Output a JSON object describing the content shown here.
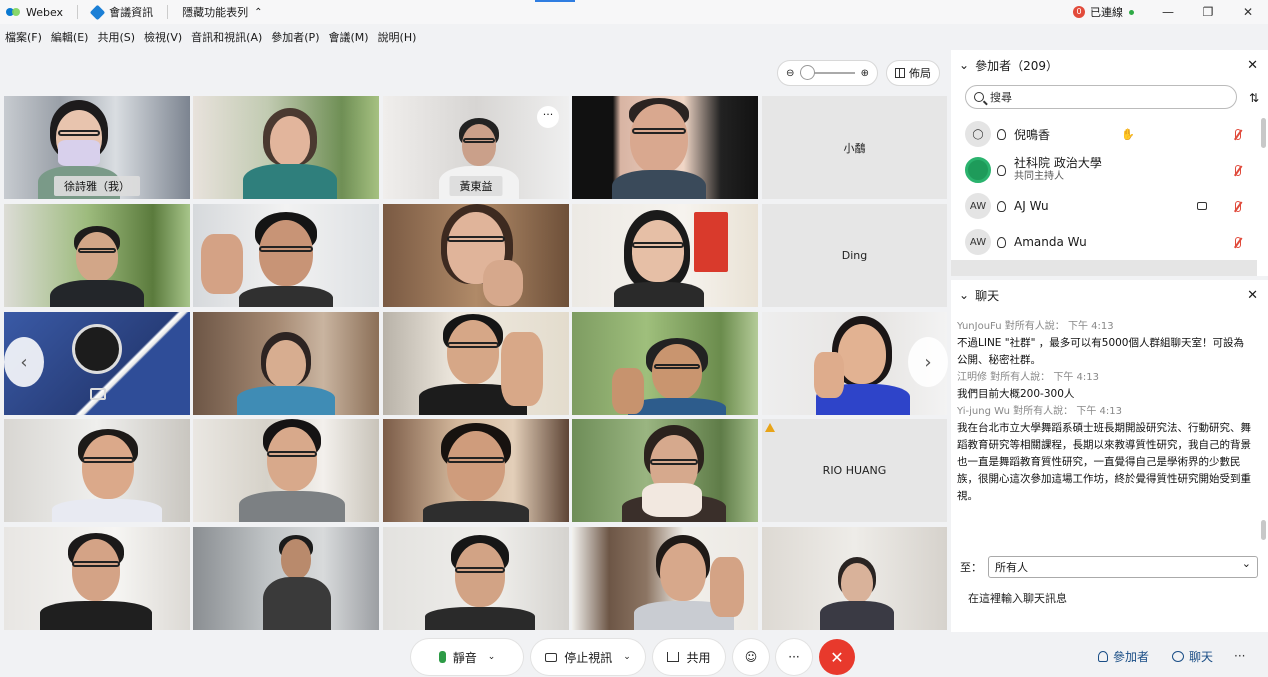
{
  "titlebar": {
    "app_name": "Webex",
    "meeting_info": "會議資訊",
    "hide_menu": "隱藏功能表列",
    "connection_count": "0",
    "connection_status": "已連線",
    "win_min": "—",
    "win_restore": "❐",
    "win_close": "✕"
  },
  "menu": [
    "檔案(F)",
    "編輯(E)",
    "共用(S)",
    "檢視(V)",
    "音訊和視訊(A)",
    "參加者(P)",
    "會議(M)",
    "說明(H)"
  ],
  "view": {
    "layout_label": "佈局",
    "zoom_level": 0.0
  },
  "tiles": {
    "self_name": "徐詩雅（我）",
    "t3_name": "黃東益",
    "t5_name": "小鷸",
    "t10_name": "Ding",
    "t20_name": "RIO HUANG",
    "more": "···"
  },
  "participants": {
    "title": "參加者（209）",
    "search_placeholder": "搜尋",
    "rows": [
      {
        "name": "倪鳴香",
        "avatar": "",
        "raised_hand": true,
        "muted": true
      },
      {
        "name": "社科院 政治大學",
        "sub": "共同主持人",
        "avatar": "",
        "muted": true
      },
      {
        "name": "AJ Wu",
        "avatar": "AW",
        "camera": true,
        "muted": true
      },
      {
        "name": "Amanda Wu",
        "avatar": "AW",
        "muted": true
      }
    ]
  },
  "chat": {
    "title": "聊天",
    "messages": [
      {
        "meta": "YunJouFu 對所有人說：    下午 4:13",
        "text": "不過LINE \"社群\" ，最多可以有5000個人群組聊天室！可設為公開、秘密社群。"
      },
      {
        "meta": "江明修 對所有人說：    下午 4:13",
        "text": "我們目前大概200-300人"
      },
      {
        "meta": "Yi-jung Wu 對所有人說：    下午 4:13",
        "text": "我在台北市立大學舞蹈系碩士班長期開設研究法、行動研究、舞蹈教育研究等相關課程，長期以來教導質性研究，我自己的背景也一直是舞蹈教育質性研究，一直覺得自己是學術界的少數民族，很開心這次參加這場工作坊，終於覺得質性研究開始受到重視。"
      }
    ],
    "to_label": "至：",
    "to_value": "所有人",
    "input_placeholder": "在這裡輸入聊天訊息"
  },
  "controls": {
    "mute": "靜音",
    "stop_video": "停止視訊",
    "share": "共用",
    "participants": "參加者",
    "chat": "聊天",
    "more": "···",
    "leave": "✕"
  }
}
